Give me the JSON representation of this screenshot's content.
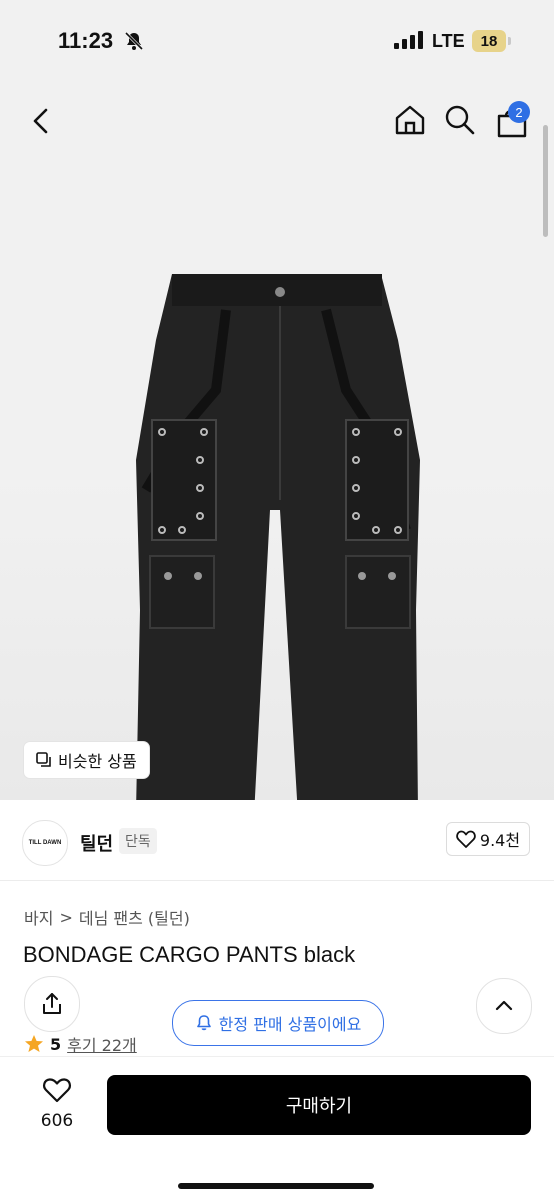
{
  "status_bar": {
    "time": "11:23",
    "network": "LTE",
    "battery": "18"
  },
  "header": {
    "cart_count": "2"
  },
  "hero": {
    "similar_label": "비슷한 상품"
  },
  "brand": {
    "logo_text": "TILL DAWN",
    "name": "틸던",
    "tag": "단독",
    "likes": "9.4천"
  },
  "breadcrumb": {
    "items": [
      "바지",
      "데님 팬츠 (틸던)"
    ],
    "separator": ">"
  },
  "product": {
    "title": "BONDAGE CARGO PANTS black"
  },
  "notice": {
    "limited_label": "한정 판매 상품이에요"
  },
  "rating": {
    "score": "5",
    "reviews": "후기 22개"
  },
  "bottom_bar": {
    "wish_count": "606",
    "buy_label": "구매하기"
  },
  "colors": {
    "accent": "#2f6fe4",
    "badge": "#2f6fe4",
    "buy_button": "#000000",
    "star": "#f5a623"
  }
}
